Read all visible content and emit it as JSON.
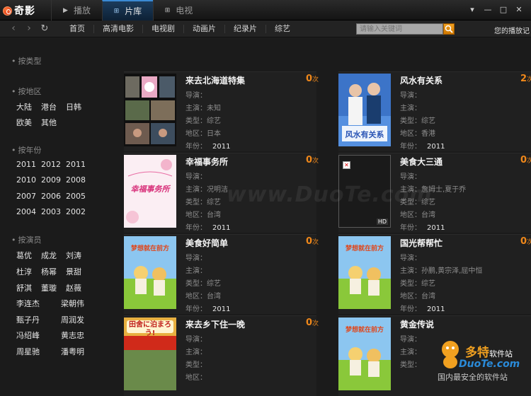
{
  "app": {
    "logo_text": "奇影"
  },
  "main_tabs": [
    {
      "label": "播放",
      "icon": "play-icon"
    },
    {
      "label": "片库",
      "icon": "grid-icon"
    },
    {
      "label": "电视",
      "icon": "grid-icon"
    }
  ],
  "window_controls": {
    "menu": "▾",
    "minimize": "—",
    "maximize": "□",
    "close": "✕"
  },
  "nav": {
    "links": [
      "首页",
      "高清电影",
      "电视剧",
      "动画片",
      "纪录片",
      "综艺"
    ],
    "search_placeholder": "请输入关键词",
    "history_label": "您的播放记"
  },
  "sidebar": {
    "type_head": "按类型",
    "region_head": "按地区",
    "regions": [
      "大陆",
      "港台",
      "日韩",
      "欧美",
      "其他"
    ],
    "year_head": "按年份",
    "years": [
      "2011",
      "2012",
      "2011",
      "2010",
      "2009",
      "2008",
      "2007",
      "2006",
      "2005",
      "2004",
      "2003",
      "2002"
    ],
    "actor_head": "按演员",
    "actors": [
      "葛优",
      "成龙",
      "刘涛",
      "杜淳",
      "杨幂",
      "景甜",
      "舒淇",
      "董璇",
      "赵薇",
      "李连杰",
      "梁朝伟",
      "甄子丹",
      "周润发",
      "冯绍峰",
      "黄志忠",
      "周星驰",
      "潘粤明"
    ]
  },
  "labels": {
    "director": "导演：",
    "starring": "主演：",
    "genre": "类型：",
    "region": "地区：",
    "year": "年份：",
    "count_unit": "次"
  },
  "cards": [
    {
      "title": "来去北海道特集",
      "count": "0",
      "starring": "未知",
      "genre": "综艺",
      "region": "日本",
      "year": "2011"
    },
    {
      "title": "风水有关系",
      "count": "2",
      "starring": "",
      "genre": "综艺",
      "region": "香港",
      "year": "2011"
    },
    {
      "title": "幸福事务所",
      "count": "0",
      "starring": "况明洁",
      "genre": "综艺",
      "region": "台湾",
      "year": "2011"
    },
    {
      "title": "美食大三通",
      "count": "0",
      "starring": "詹姆士,夏于乔",
      "genre": "综艺",
      "region": "台湾",
      "year": "2011"
    },
    {
      "title": "美食好简单",
      "count": "0",
      "starring": "",
      "genre": "综艺",
      "region": "台湾",
      "year": "2011"
    },
    {
      "title": "国光帮帮忙",
      "count": "0",
      "starring": "孙鹏,黄宗泽,屈中恒",
      "genre": "综艺",
      "region": "台湾",
      "year": "2011"
    },
    {
      "title": "来去乡下住一晚",
      "count": "0",
      "starring": "",
      "genre": "",
      "region": "",
      "year": ""
    },
    {
      "title": "黄金传说",
      "count": "",
      "starring": "",
      "genre": "",
      "region": "",
      "year": ""
    }
  ],
  "poster_text": {
    "p2": "风水有关系",
    "p3": "幸福事务所",
    "p4_tag": "HD",
    "p5": "梦想就在前方",
    "p6": "梦想就在前方",
    "p7": "田舍に泊まろう!",
    "p8": "梦想就在前方"
  },
  "watermark": "www.DuoTe.com",
  "site_badge": {
    "name": "多特",
    "suffix": "软件站",
    "domain": "DuoTe.com",
    "slogan": "国内最安全的软件站"
  },
  "colors": {
    "accent": "#f0881a",
    "tab_active": "#1c3c5c"
  }
}
